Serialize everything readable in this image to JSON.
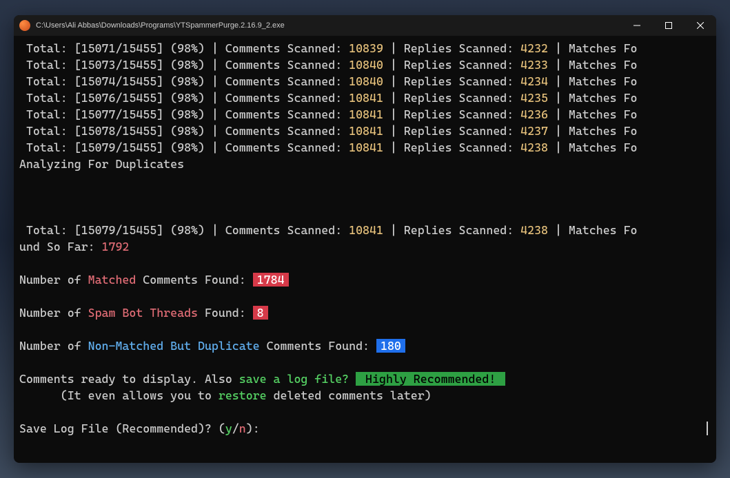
{
  "window": {
    "title": "C:\\Users\\Ali Abbas\\Downloads\\Programs\\YTSpammerPurge.2.16.9_2.exe"
  },
  "scanLines": [
    {
      "curr": "15071",
      "total": "15455",
      "pct": "98%",
      "comments": "10839",
      "replies": "4232"
    },
    {
      "curr": "15073",
      "total": "15455",
      "pct": "98%",
      "comments": "10840",
      "replies": "4233"
    },
    {
      "curr": "15074",
      "total": "15455",
      "pct": "98%",
      "comments": "10840",
      "replies": "4234"
    },
    {
      "curr": "15076",
      "total": "15455",
      "pct": "98%",
      "comments": "10841",
      "replies": "4235"
    },
    {
      "curr": "15077",
      "total": "15455",
      "pct": "98%",
      "comments": "10841",
      "replies": "4236"
    },
    {
      "curr": "15078",
      "total": "15455",
      "pct": "98%",
      "comments": "10841",
      "replies": "4237"
    },
    {
      "curr": "15079",
      "total": "15455",
      "pct": "98%",
      "comments": "10841",
      "replies": "4238"
    }
  ],
  "labels": {
    "totalPrefix": " Total: [",
    "totalSep": "/",
    "totalClose": "] (",
    "pctClose": ") | Comments Scanned: ",
    "repliesPrefix": " | Replies Scanned: ",
    "matchesPrefix": " | Matches Fo",
    "analyzing": "Analyzing For Duplicates"
  },
  "summary": {
    "curr": "15079",
    "total": "15455",
    "pct": "98%",
    "comments": "10841",
    "replies": "4238",
    "wrapPrefix": "und So Far: ",
    "foundSoFar": "1792"
  },
  "results": {
    "matchedPrefix": "Number of ",
    "matchedLabel": "Matched",
    "matchedSuffix": " Comments Found: ",
    "matchedCount": "1784",
    "spamLabel": "Spam Bot Threads",
    "spamSuffix": " Found: ",
    "spamCount": "8",
    "nonMatchedLabel": "Non-Matched But Duplicate",
    "nonMatchedSuffix": " Comments Found: ",
    "nonMatchedCount": "180"
  },
  "prompt": {
    "line1a": "Comments ready to display. Also ",
    "saveLog": "save a log file?",
    "highly": " Highly Recommended! ",
    "line2a": "      (It even allows you to ",
    "restore": "restore",
    "line2b": " deleted comments later)",
    "savePrompt": "Save Log File (Recommended)? (",
    "y": "y",
    "slash": "/",
    "n": "n",
    "close": "): "
  }
}
